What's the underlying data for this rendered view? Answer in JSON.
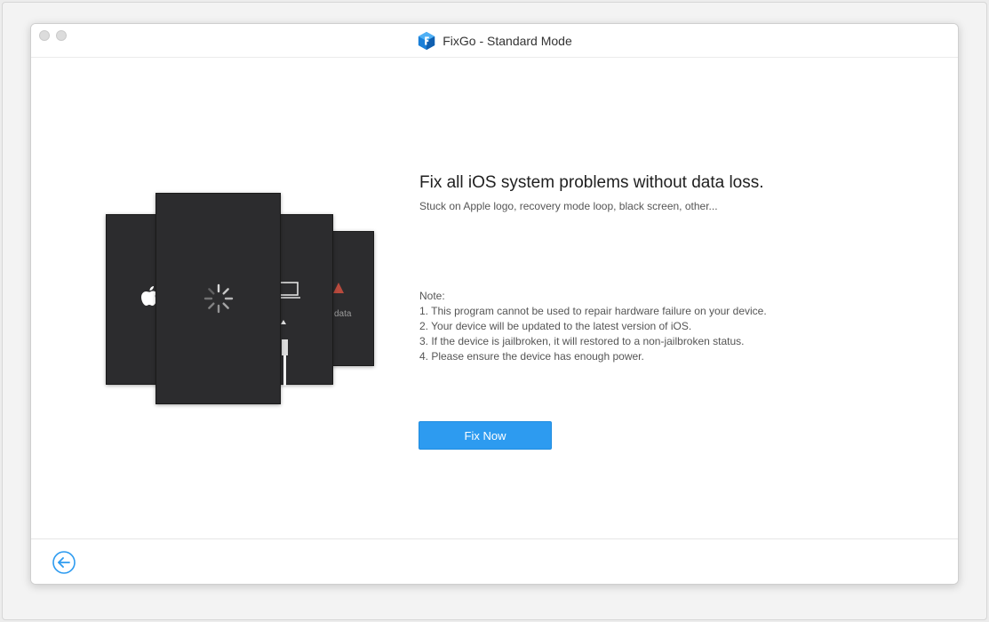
{
  "window": {
    "title": "FixGo - Standard Mode",
    "app_logo_icon": "fixgo-cube-logo"
  },
  "illustration": {
    "card_d_label": "data",
    "icons": [
      "apple-logo-icon",
      "loading-spinner-icon",
      "laptop-icon",
      "arrow-up-icon",
      "cable-icon",
      "warning-icon"
    ]
  },
  "main": {
    "headline": "Fix all iOS system problems without data loss.",
    "subline": "Stuck on Apple logo, recovery mode loop, black screen, other...",
    "notes": {
      "title": "Note:",
      "items": [
        "1. This program cannot be used to repair hardware failure on your device.",
        "2. Your device will be updated to the latest version of iOS.",
        "3. If the device is jailbroken, it will restored to a non-jailbroken status.",
        "4. Please ensure the device has enough power."
      ]
    },
    "fix_button_label": "Fix Now"
  },
  "footer": {
    "back_icon": "back-arrow-circle-icon"
  },
  "colors": {
    "accent": "#2d9bf0",
    "card": "#2c2c2e",
    "logo_blue": "#1a7fd8"
  }
}
